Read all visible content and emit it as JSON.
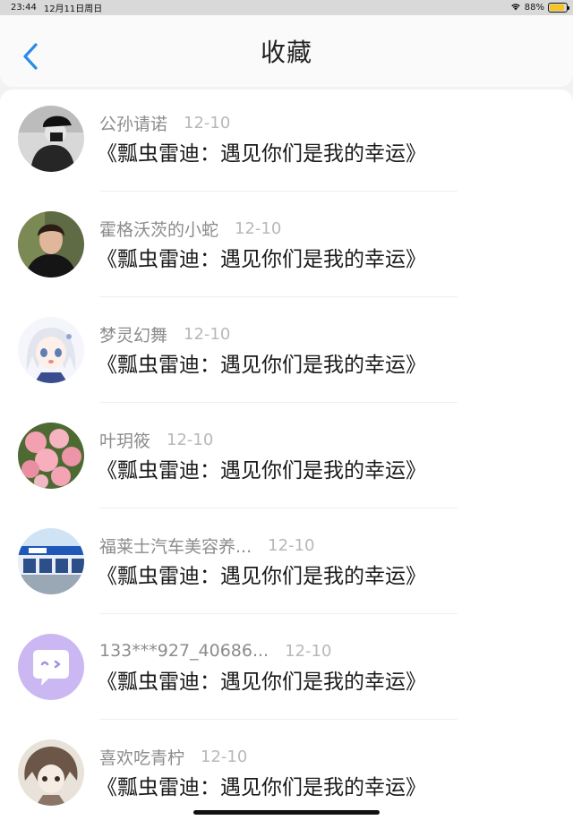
{
  "status": {
    "time": "23:44",
    "date": "12月11日周日",
    "battery": "88%",
    "battery_level": 0.88,
    "wifi_icon": "wifi-icon"
  },
  "nav": {
    "title": "收藏",
    "back_icon": "chevron-left-icon"
  },
  "colors": {
    "accent": "#2a8be8",
    "name": "#8c8c8c",
    "date": "#b8b8b8",
    "title": "#1a1a1a"
  },
  "favorites": [
    {
      "name": "公孙请诺",
      "date": "12-10",
      "title": "《瓢虫雷迪：遇见你们是我的幸运》",
      "avatar": "grayscale-cap-person"
    },
    {
      "name": "霍格沃茨的小蛇",
      "date": "12-10",
      "title": "《瓢虫雷迪：遇见你们是我的幸运》",
      "avatar": "dark-haired-man"
    },
    {
      "name": "梦灵幻舞",
      "date": "12-10",
      "title": "《瓢虫雷迪：遇见你们是我的幸运》",
      "avatar": "anime-girl"
    },
    {
      "name": "叶玥筱",
      "date": "12-10",
      "title": "《瓢虫雷迪：遇见你们是我的幸运》",
      "avatar": "pink-flowers"
    },
    {
      "name": "福莱士汽车美容养...",
      "date": "12-10",
      "title": "《瓢虫雷迪：遇见你们是我的幸运》",
      "avatar": "storefront"
    },
    {
      "name": "133***927_40686...",
      "date": "12-10",
      "title": "《瓢虫雷迪：遇见你们是我的幸运》",
      "avatar": "purple-chat-bubble"
    },
    {
      "name": "喜欢吃青柠",
      "date": "12-10",
      "title": "《瓢虫雷迪：遇见你们是我的幸运》",
      "avatar": "sketch-anime-character"
    }
  ]
}
